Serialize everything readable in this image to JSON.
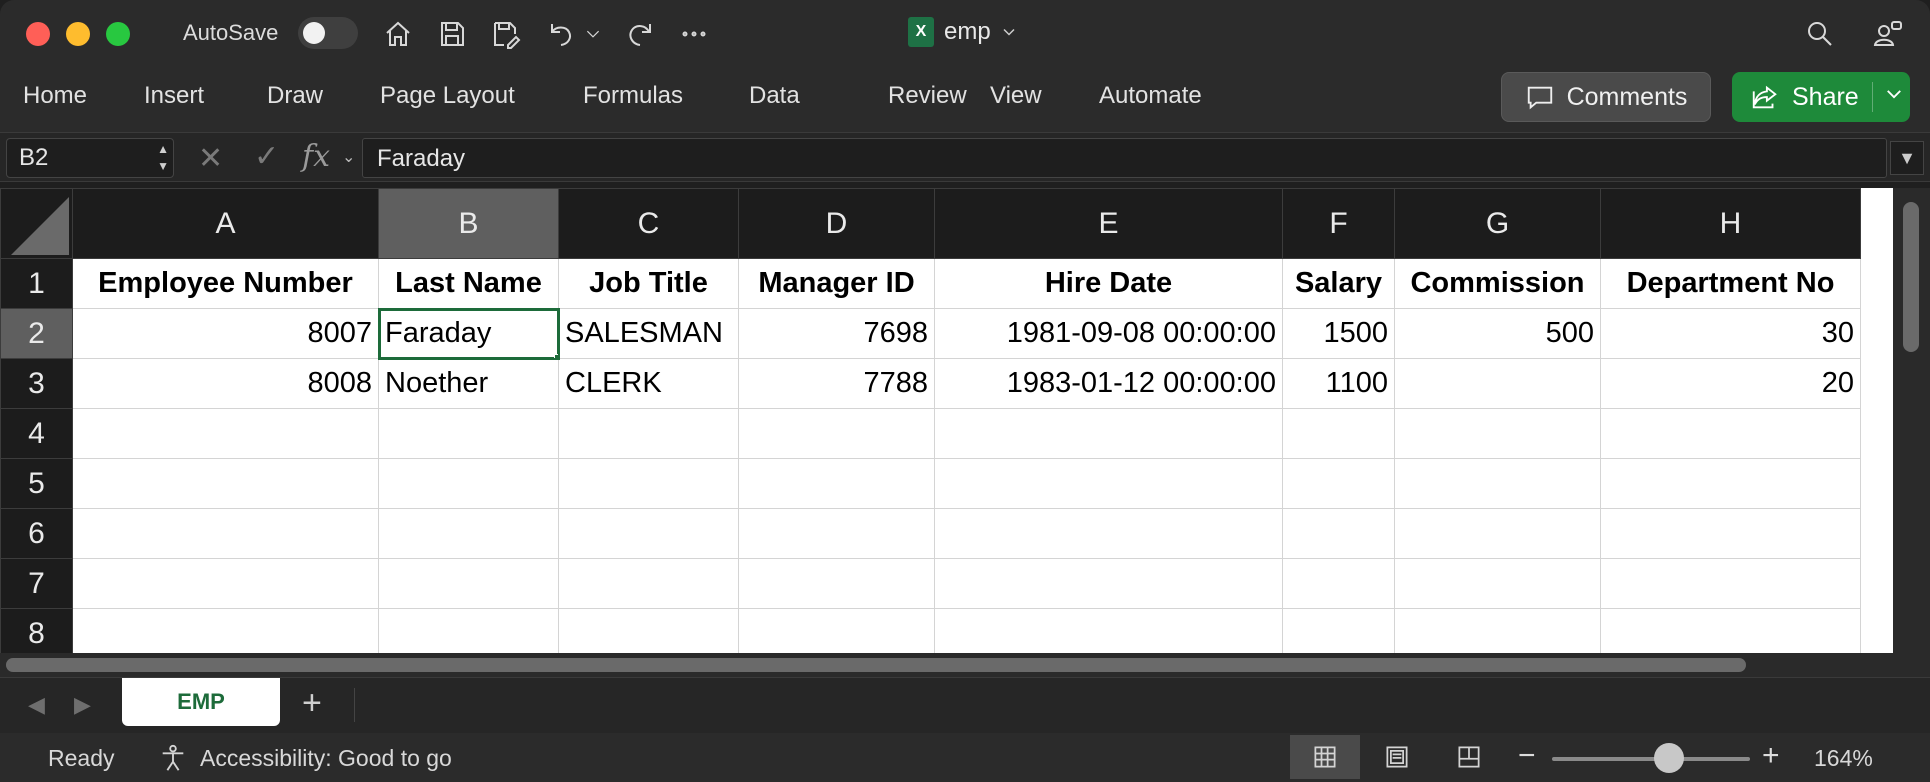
{
  "titlebar": {
    "autosave_label": "AutoSave",
    "document_name": "emp",
    "xl_badge": "X"
  },
  "ribbon": {
    "tabs": [
      "Home",
      "Insert",
      "Draw",
      "Page Layout",
      "Formulas",
      "Data",
      "Review",
      "View",
      "Automate"
    ],
    "comments_label": "Comments",
    "share_label": "Share"
  },
  "formula_bar": {
    "name_box": "B2",
    "fx_label": "fx",
    "value": "Faraday"
  },
  "sheet": {
    "columns": [
      "A",
      "B",
      "C",
      "D",
      "E",
      "F",
      "G",
      "H"
    ],
    "rows": [
      "1",
      "2",
      "3",
      "4",
      "5",
      "6",
      "7",
      "8"
    ],
    "headers": [
      "Employee Number",
      "Last Name",
      "Job Title",
      "Manager ID",
      "Hire Date",
      "Salary",
      "Commission",
      "Department No"
    ],
    "data": [
      [
        "8007",
        "Faraday",
        "SALESMAN",
        "7698",
        "1981-09-08 00:00:00",
        "1500",
        "500",
        "30"
      ],
      [
        "8008",
        "Noether",
        "CLERK",
        "7788",
        "1983-01-12 00:00:00",
        "1100",
        "",
        "20"
      ]
    ],
    "active_cell": "B2"
  },
  "sheet_tabs": {
    "tabs": [
      "EMP"
    ],
    "add_label": "+"
  },
  "status": {
    "ready": "Ready",
    "accessibility": "Accessibility: Good to go",
    "zoom": "164%",
    "zoom_value_percent": 164
  },
  "colors": {
    "accent_green": "#1d6b3a",
    "share_green": "#1e8a3a",
    "dark_bg": "#2b2b2b"
  }
}
